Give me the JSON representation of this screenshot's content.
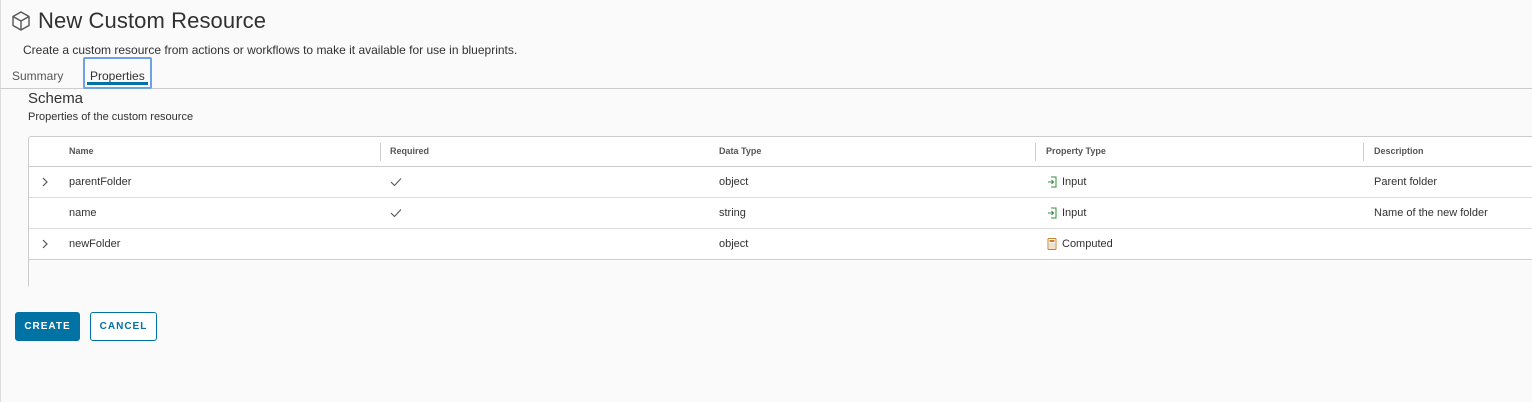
{
  "header": {
    "title": "New Custom Resource",
    "subtitle": "Create a custom resource from actions or workflows to make it available for use in blueprints.",
    "icon": "cube-icon"
  },
  "tabs": [
    {
      "label": "Summary",
      "selected": false
    },
    {
      "label": "Properties",
      "selected": true
    }
  ],
  "schema": {
    "title": "Schema",
    "subtitle": "Properties of the custom resource"
  },
  "table": {
    "columns": [
      "Name",
      "Required",
      "Data Type",
      "Property Type",
      "Description"
    ],
    "rows": [
      {
        "name": "parentFolder",
        "required": true,
        "data_type": "object",
        "property_type": "Input",
        "description": "Parent folder",
        "expandable": true
      },
      {
        "name": "name",
        "required": true,
        "data_type": "string",
        "property_type": "Input",
        "description": "Name of the new folder",
        "expandable": false
      },
      {
        "name": "newFolder",
        "required": false,
        "data_type": "object",
        "property_type": "Computed",
        "description": "",
        "expandable": true
      }
    ]
  },
  "actions": {
    "create_label": "CREATE",
    "cancel_label": "CANCEL"
  },
  "colors": {
    "primary": "#0072a3",
    "focus": "#6da3e6",
    "input_icon": "#2f8c3f",
    "computed_icon": "#c7812b"
  }
}
